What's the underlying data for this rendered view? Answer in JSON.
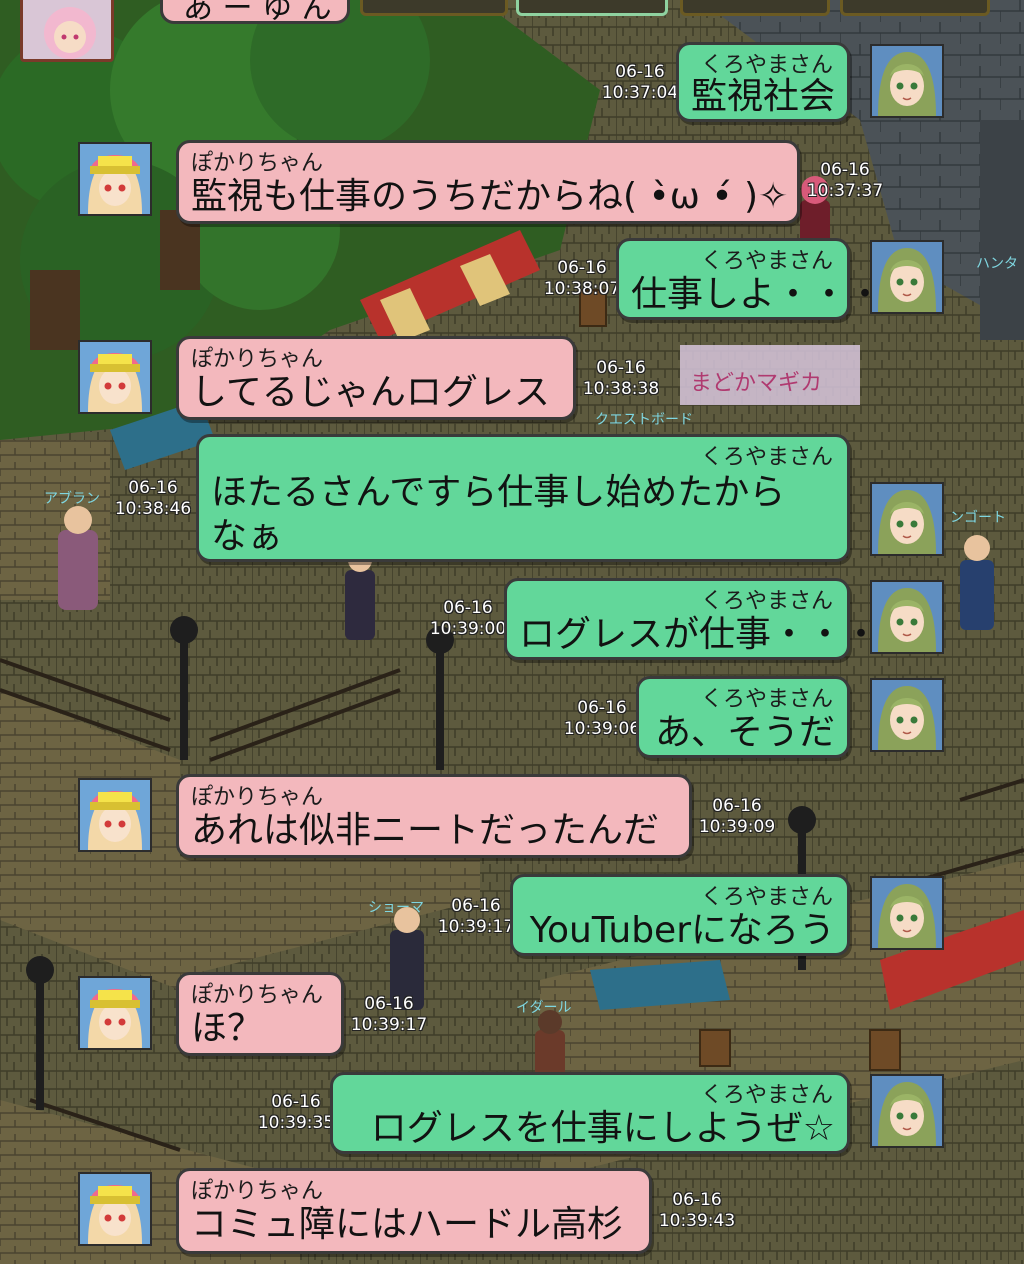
{
  "top_partial_message": "あ ー ゆ ん",
  "messages": [
    {
      "side": "right",
      "name": "くろやまさん",
      "text": "監視社会",
      "date": "06-16",
      "time": "10:37:04"
    },
    {
      "side": "left",
      "name": "ぽかりちゃん",
      "text": "監視も仕事のうちだからね( •̀ω •́ )✧",
      "date": "06-16",
      "time": "10:37:37"
    },
    {
      "side": "right",
      "name": "くろやまさん",
      "text": "仕事しよ・・・",
      "date": "06-16",
      "time": "10:38:07"
    },
    {
      "side": "left",
      "name": "ぽかりちゃん",
      "text": "してるじゃんログレス",
      "date": "06-16",
      "time": "10:38:38"
    },
    {
      "side": "right",
      "name": "くろやまさん",
      "text": "ほたるさんですら仕事し始めたから",
      "text2": "なぁ",
      "date": "06-16",
      "time": "10:38:46"
    },
    {
      "side": "right",
      "name": "くろやまさん",
      "text": "ログレスが仕事・・・",
      "date": "06-16",
      "time": "10:39:00"
    },
    {
      "side": "right",
      "name": "くろやまさん",
      "text": "あ、そうだ",
      "date": "06-16",
      "time": "10:39:06"
    },
    {
      "side": "left",
      "name": "ぽかりちゃん",
      "text": "あれは似非ニートだったんだ",
      "date": "06-16",
      "time": "10:39:09"
    },
    {
      "side": "right",
      "name": "くろやまさん",
      "text": "YouTuberになろう",
      "date": "06-16",
      "time": "10:39:17"
    },
    {
      "side": "left",
      "name": "ぽかりちゃん",
      "text": "ほ？",
      "date": "06-16",
      "time": "10:39:17"
    },
    {
      "side": "right",
      "name": "くろやまさん",
      "text": "ログレスを仕事にしようぜ☆",
      "date": "06-16",
      "time": "10:39:35"
    },
    {
      "side": "left",
      "name": "ぽかりちゃん",
      "text": "コミュ障にはハードル高杉",
      "date": "06-16",
      "time": "10:39:43"
    }
  ],
  "colors": {
    "pink_bubble": "#f3b8bd",
    "green_bubble": "#62d79a"
  },
  "icons": {
    "right_avatar": "green-haired-girl-avatar",
    "left_avatar": "pink-cap-girl-avatar"
  }
}
